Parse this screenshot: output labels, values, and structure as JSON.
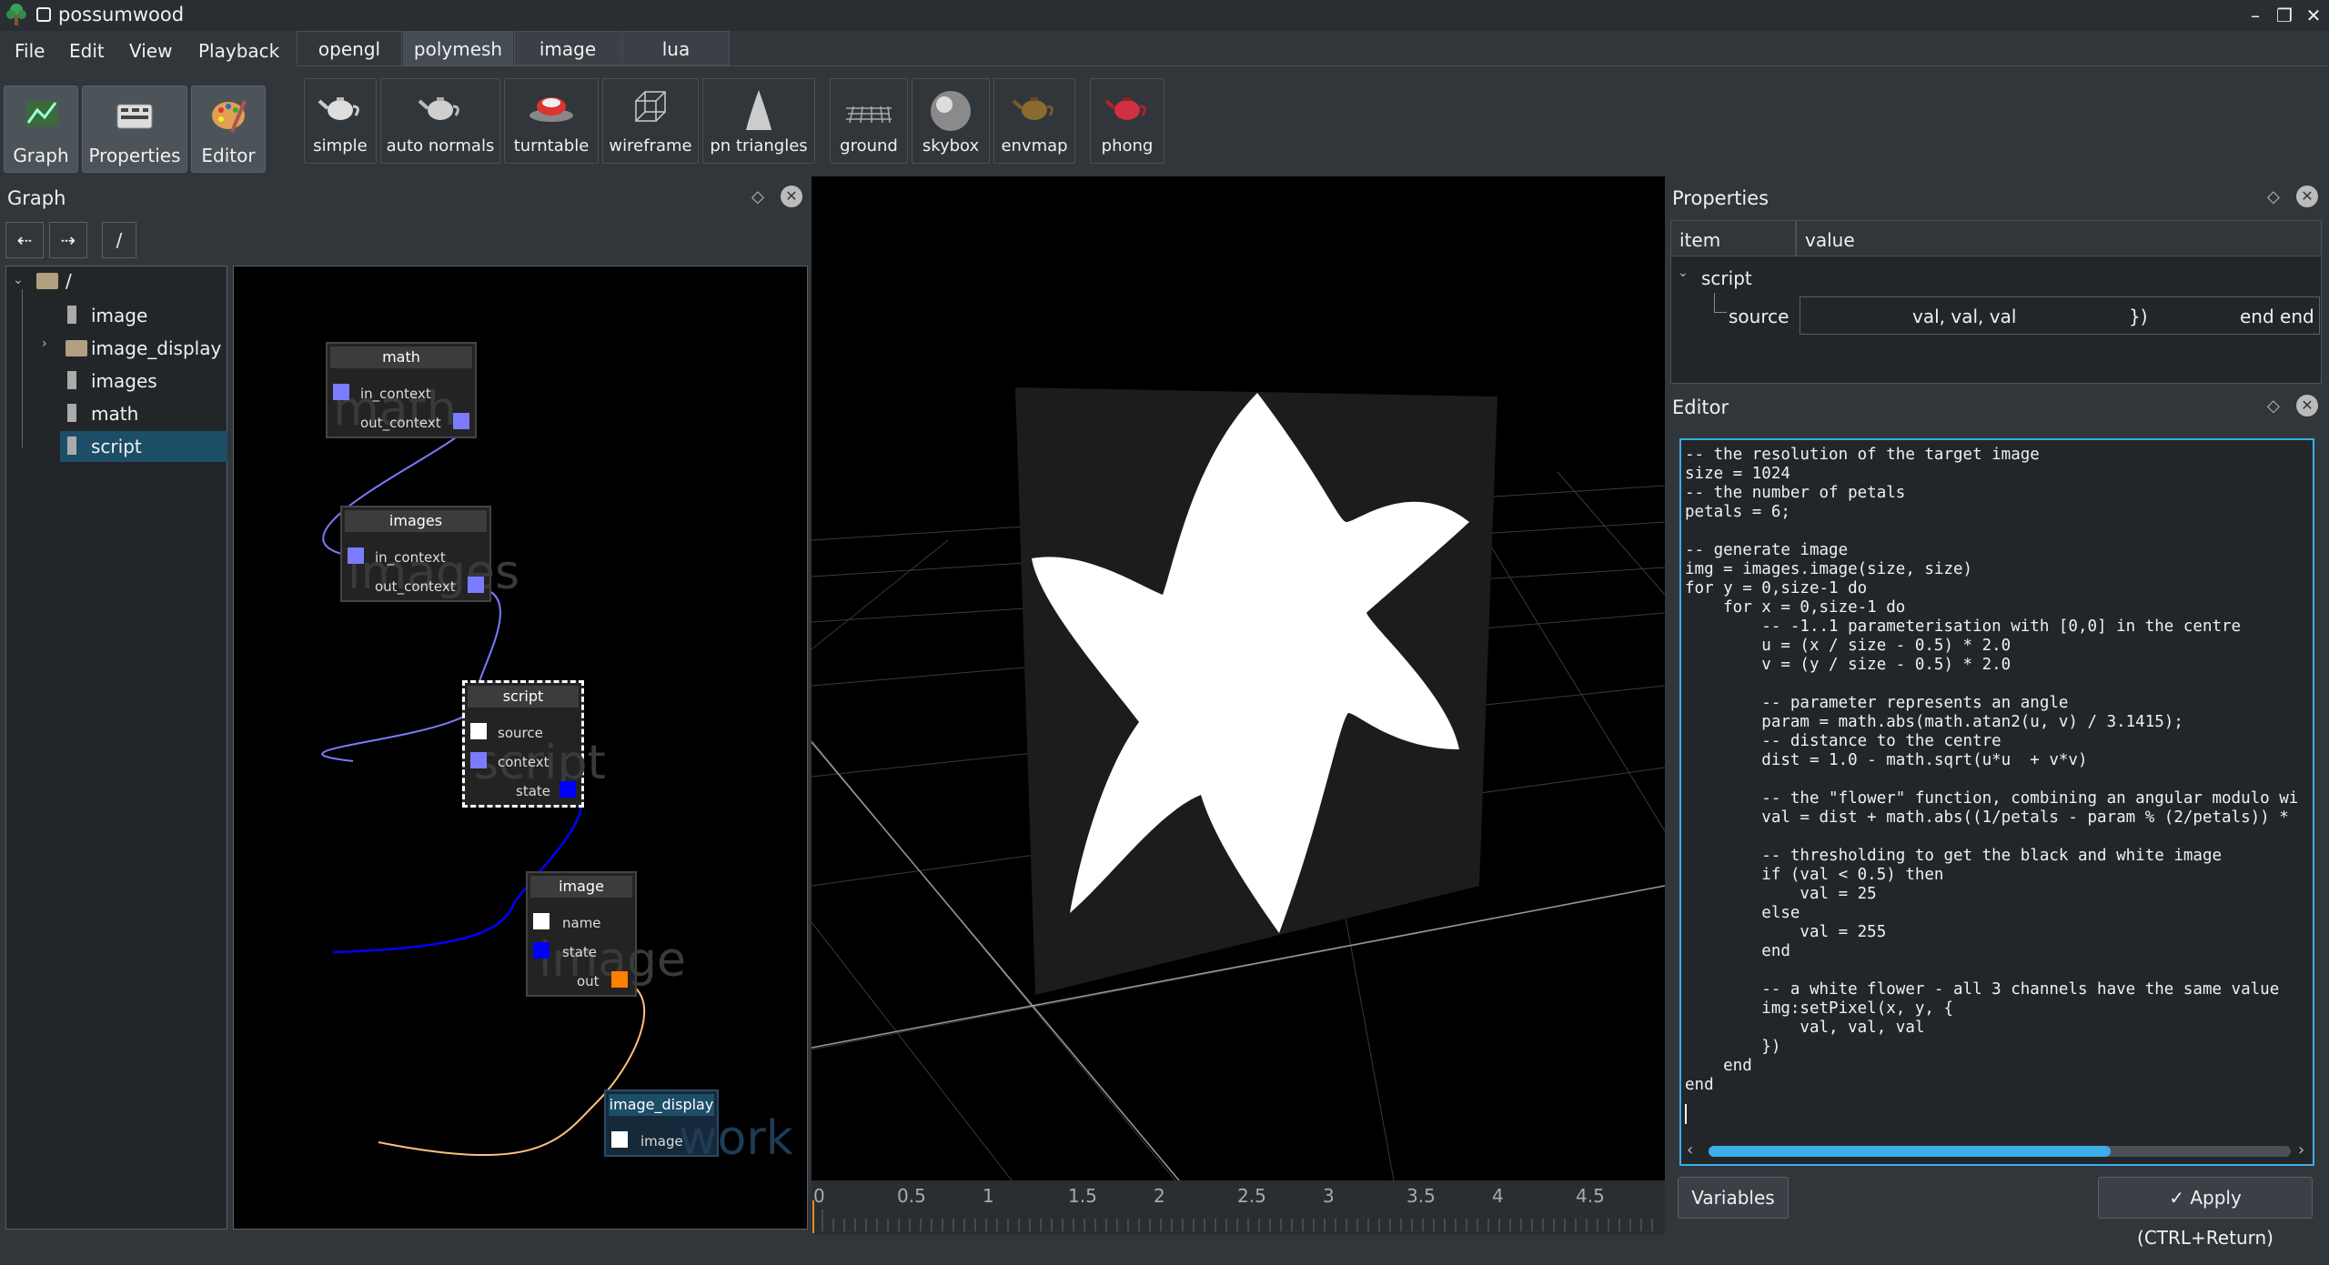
{
  "app": {
    "title": "possumwood"
  },
  "menu": [
    "File",
    "Edit",
    "View",
    "Playback"
  ],
  "dock_buttons": [
    {
      "label": "Graph",
      "icon": "graph-icon"
    },
    {
      "label": "Properties",
      "icon": "properties-icon"
    },
    {
      "label": "Editor",
      "icon": "editor-icon"
    }
  ],
  "toolbar_tabs": [
    "opengl",
    "polymesh",
    "image",
    "lua"
  ],
  "toolbar_tools": [
    {
      "label": "simple",
      "icon": "teapot-simple-icon"
    },
    {
      "label": "auto normals",
      "icon": "teapot-normals-icon"
    },
    {
      "label": "turntable",
      "icon": "turntable-icon"
    },
    {
      "label": "wireframe",
      "icon": "wireframe-cube-icon"
    },
    {
      "label": "pn triangles",
      "icon": "pn-triangles-icon"
    },
    {
      "label": "ground",
      "icon": "ground-icon"
    },
    {
      "label": "skybox",
      "icon": "skybox-icon"
    },
    {
      "label": "envmap",
      "icon": "envmap-icon"
    },
    {
      "label": "phong",
      "icon": "phong-teapot-icon"
    }
  ],
  "graph": {
    "title": "Graph",
    "path": "/",
    "tree": {
      "root": "/",
      "items": [
        "image",
        "image_display",
        "images",
        "math",
        "script"
      ],
      "selected": "script"
    },
    "nodes": {
      "math": {
        "title": "math",
        "ghost": "math",
        "ports": [
          "in_context",
          "out_context"
        ]
      },
      "images": {
        "title": "images",
        "ghost": "images",
        "ports": [
          "in_context",
          "out_context"
        ]
      },
      "script": {
        "title": "script",
        "ghost": "script",
        "ports": [
          "source",
          "context",
          "state"
        ]
      },
      "image": {
        "title": "image",
        "ghost": "image",
        "ports": [
          "name",
          "state",
          "out"
        ]
      },
      "image_display": {
        "title": "image_display",
        "ghost": "work",
        "ports": [
          "image"
        ]
      }
    }
  },
  "timeline": {
    "ticks": [
      "0",
      "0.5",
      "1",
      "1.5",
      "2",
      "2.5",
      "3",
      "3.5",
      "4",
      "4.5"
    ]
  },
  "properties": {
    "title": "Properties",
    "col_item": "item",
    "col_value": "value",
    "group": "script",
    "row_name": "source",
    "row_value_parts": [
      "val, val, val",
      "})",
      "end end"
    ]
  },
  "editor": {
    "title": "Editor",
    "code": "-- the resolution of the target image\nsize = 1024\n-- the number of petals\npetals = 6;\n\n-- generate image\nimg = images.image(size, size)\nfor y = 0,size-1 do\n    for x = 0,size-1 do\n        -- -1..1 parameterisation with [0,0] in the centre\n        u = (x / size - 0.5) * 2.0\n        v = (y / size - 0.5) * 2.0\n\n        -- parameter represents an angle\n        param = math.abs(math.atan2(u, v) / 3.1415);\n        -- distance to the centre\n        dist = 1.0 - math.sqrt(u*u  + v*v)\n\n        -- the \"flower\" function, combining an angular modulo wi\n        val = dist + math.abs((1/petals - param % (2/petals)) *\n\n        -- thresholding to get the black and white image\n        if (val < 0.5) then\n            val = 25\n        else\n            val = 255\n        end\n\n        -- a white flower - all 3 channels have the same value\n        img:setPixel(x, y, {\n            val, val, val\n        })\n    end\nend",
    "variables_label": "Variables",
    "apply_label": "Apply (CTRL+Return)",
    "scroll_position": 0.69
  },
  "colors": {
    "background": "#31363b",
    "accent": "#3daee9",
    "port_context": "#7b7bff",
    "port_state": "#0000ff",
    "port_out": "#ff8000",
    "wire_out": "#ffbf80"
  }
}
